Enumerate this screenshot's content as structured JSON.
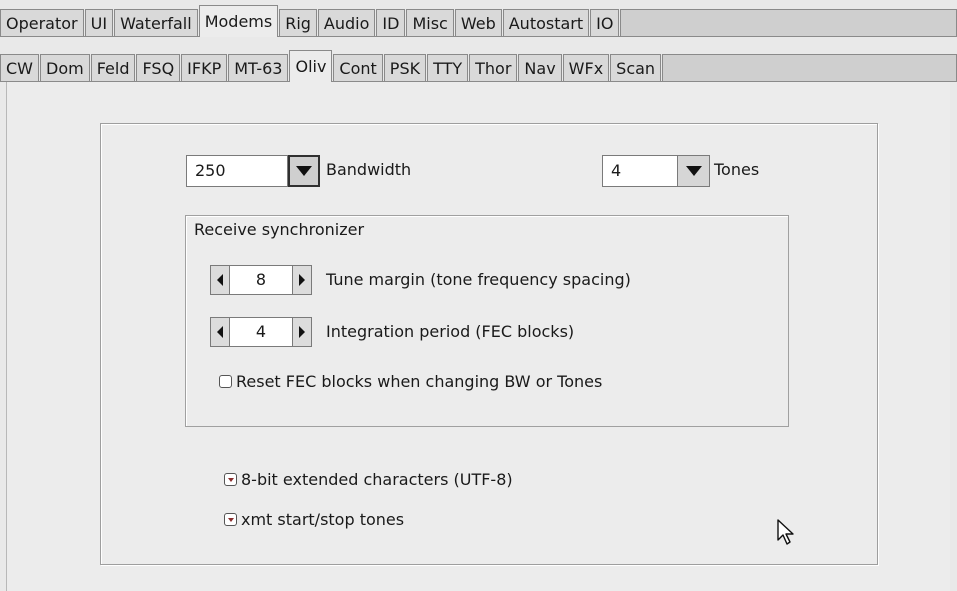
{
  "top_tabs": [
    {
      "label": "Operator",
      "active": false
    },
    {
      "label": "UI",
      "active": false
    },
    {
      "label": "Waterfall",
      "active": false
    },
    {
      "label": "Modems",
      "active": true
    },
    {
      "label": "Rig",
      "active": false
    },
    {
      "label": "Audio",
      "active": false
    },
    {
      "label": "ID",
      "active": false
    },
    {
      "label": "Misc",
      "active": false
    },
    {
      "label": "Web",
      "active": false
    },
    {
      "label": "Autostart",
      "active": false
    },
    {
      "label": "IO",
      "active": false
    }
  ],
  "modem_tabs": [
    {
      "label": "CW",
      "active": false
    },
    {
      "label": "Dom",
      "active": false
    },
    {
      "label": "Feld",
      "active": false
    },
    {
      "label": "FSQ",
      "active": false
    },
    {
      "label": "IFKP",
      "active": false
    },
    {
      "label": "MT-63",
      "active": false
    },
    {
      "label": "Oliv",
      "active": true
    },
    {
      "label": "Cont",
      "active": false
    },
    {
      "label": "PSK",
      "active": false
    },
    {
      "label": "TTY",
      "active": false
    },
    {
      "label": "Thor",
      "active": false
    },
    {
      "label": "Nav",
      "active": false
    },
    {
      "label": "WFx",
      "active": false
    },
    {
      "label": "Scan",
      "active": false
    }
  ],
  "bandwidth": {
    "value": "250",
    "label": "Bandwidth"
  },
  "tones": {
    "value": "4",
    "label": "Tones"
  },
  "receive_group": {
    "title": "Receive synchronizer",
    "tune_margin": {
      "value": "8",
      "label": "Tune margin (tone frequency spacing)"
    },
    "integration": {
      "value": "4",
      "label": "Integration period (FEC blocks)"
    },
    "reset_fec": {
      "label": "Reset FEC blocks when changing BW or Tones",
      "checked": false
    }
  },
  "utf8": {
    "label": "8-bit extended characters (UTF-8)",
    "checked": true
  },
  "xmt_tones": {
    "label": "xmt start/stop tones",
    "checked": true
  },
  "icons": {
    "dropdown": "chevron-down-icon",
    "decrement": "arrow-left-icon",
    "increment": "arrow-right-icon",
    "pointer": "mouse-pointer-icon"
  }
}
